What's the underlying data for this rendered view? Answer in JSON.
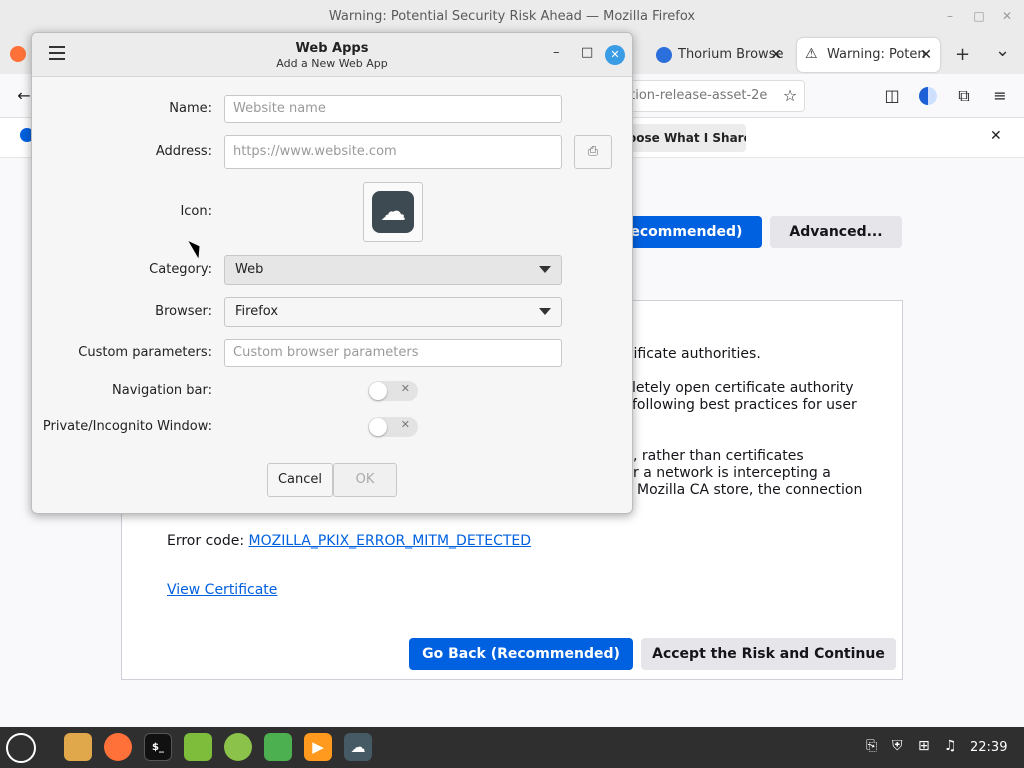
{
  "firefox": {
    "window_title": "Warning: Potential Security Risk Ahead — Mozilla Firefox",
    "window_controls": {
      "minimize": "–",
      "maximize": "□",
      "close": "✕"
    },
    "tabs": [
      {
        "label": "Thorium Browse",
        "close": "✕"
      },
      {
        "label": "Warning: Poten",
        "close": "✕"
      }
    ],
    "new_tab": "+",
    "tab_list": "⌄",
    "url_text": "ction-release-asset-2e",
    "notification_button": "oose What I Share",
    "notification_close": "✕",
    "top_buttons": {
      "recommended": "Recommended)",
      "advanced": "Advanced..."
    },
    "body_lines": [
      "tificate authorities.",
      "letely open certificate authority",
      "following best practices for user",
      ", rather than certificates",
      "r a network is intercepting a",
      "Mozilla CA store, the connection"
    ],
    "error_code_label": "Error code:",
    "error_code": "MOZILLA_PKIX_ERROR_MITM_DETECTED",
    "view_certificate": "View Certificate",
    "go_back": "Go Back (Recommended)",
    "accept_risk": "Accept the Risk and Continue"
  },
  "dialog": {
    "title": "Web Apps",
    "subtitle": "Add a New Web App",
    "controls": {
      "minimize": "–",
      "maximize": "□",
      "close": "✕"
    },
    "fields": {
      "name_label": "Name:",
      "name_placeholder": "Website name",
      "address_label": "Address:",
      "address_placeholder": "https://www.website.com",
      "icon_label": "Icon:",
      "category_label": "Category:",
      "category_value": "Web",
      "browser_label": "Browser:",
      "browser_value": "Firefox",
      "custom_label": "Custom parameters:",
      "custom_placeholder": "Custom browser parameters",
      "navbar_label": "Navigation bar:",
      "private_label": "Private/Incognito Window:"
    },
    "buttons": {
      "cancel": "Cancel",
      "ok": "OK"
    }
  },
  "taskbar": {
    "clock": "22:39",
    "terminal_glyph": "$_"
  },
  "colors": {
    "accent": "#0061e0",
    "dialog_close": "#3b9ce6",
    "taskbar": "#2f2f2f"
  }
}
